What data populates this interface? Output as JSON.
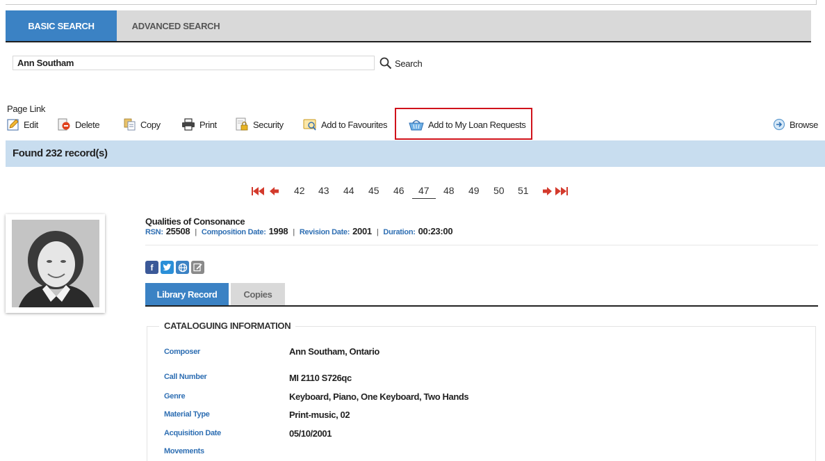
{
  "tabs": {
    "basic": "BASIC SEARCH",
    "advanced": "ADVANCED SEARCH"
  },
  "search": {
    "value": "Ann Southam",
    "button_label": "Search"
  },
  "toolbar": {
    "page_link": "Page Link",
    "edit": "Edit",
    "delete": "Delete",
    "copy": "Copy",
    "print": "Print",
    "security": "Security",
    "add_favourites": "Add to Favourites",
    "add_loan": "Add to My Loan Requests",
    "browse": "Browse"
  },
  "results": {
    "found_text": "Found 232 record(s)"
  },
  "pagination": {
    "pages": [
      "42",
      "43",
      "44",
      "45",
      "46",
      "47",
      "48",
      "49",
      "50",
      "51"
    ],
    "current": "47"
  },
  "record": {
    "title": "Qualities of Consonance",
    "rsn_label": "RSN:",
    "rsn": "25508",
    "comp_date_label": "Composition Date:",
    "comp_date": "1998",
    "rev_date_label": "Revision Date:",
    "rev_date": "2001",
    "duration_label": "Duration:",
    "duration": "00:23:00",
    "separator": "|"
  },
  "social": {
    "facebook": "f",
    "twitter": "t"
  },
  "record_tabs": {
    "library": "Library Record",
    "copies": "Copies"
  },
  "cataloguing": {
    "legend": "CATALOGUING INFORMATION",
    "fields": [
      {
        "label": "Composer",
        "value": "Ann Southam, Ontario"
      },
      {
        "label": "Call Number",
        "value": "MI 2110 S726qc"
      },
      {
        "label": "Genre",
        "value": "Keyboard, Piano, One Keyboard, Two Hands"
      },
      {
        "label": "Material Type",
        "value": "Print-music, 02"
      },
      {
        "label": "Acquisition Date",
        "value": "05/10/2001"
      },
      {
        "label": "Movements",
        "value": ""
      }
    ]
  },
  "colors": {
    "primary_blue": "#3b82c4",
    "found_bar": "#c8ddef",
    "highlight_red": "#d0121b",
    "label_blue": "#2f6fb3",
    "facebook": "#3b5998",
    "twitter": "#1da1f2"
  },
  "icons": [
    "search-icon",
    "edit-icon",
    "delete-icon",
    "copy-icon",
    "print-icon",
    "security-icon",
    "favourites-icon",
    "loan-basket-icon",
    "browse-icon",
    "first-page-icon",
    "prev-page-icon",
    "next-page-icon",
    "last-page-icon",
    "facebook-icon",
    "twitter-icon",
    "web-icon",
    "note-icon"
  ]
}
